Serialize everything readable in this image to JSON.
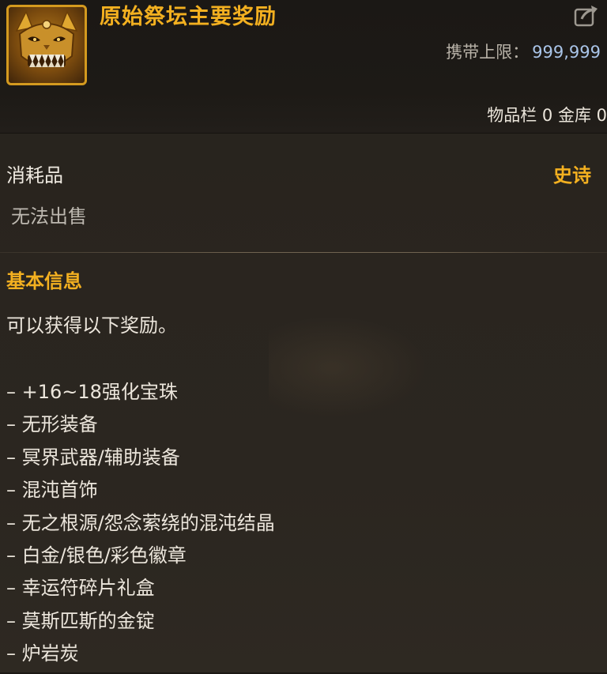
{
  "item": {
    "title": "原始祭坛主要奖励",
    "icon": "golden-demon-mask-icon",
    "carry_limit_label": "携带上限：",
    "carry_limit_value": "999,999",
    "inventory_text": "物品栏 0 金库 0",
    "category": "消耗品",
    "rarity": "史诗",
    "tradable": "无法出售"
  },
  "basic_info": {
    "title": "基本信息",
    "description": "可以获得以下奖励。",
    "rewards": [
      "– +16~18强化宝珠",
      "– 无形装备",
      "– 冥界武器/辅助装备",
      "– 混沌首饰",
      "– 无之根源/怨念萦绕的混沌结晶",
      "– 白金/银色/彩色徽章",
      "– 幸运符碎片礼盒",
      "– 莫斯匹斯的金锭",
      "– 炉岩炭"
    ]
  },
  "colors": {
    "rarity_epic": "#f3b020",
    "section_title": "#f3b020",
    "carry_value": "#a9c4e8",
    "icon_border": "#d49a1f"
  },
  "icons": {
    "export": "share-export-icon"
  }
}
